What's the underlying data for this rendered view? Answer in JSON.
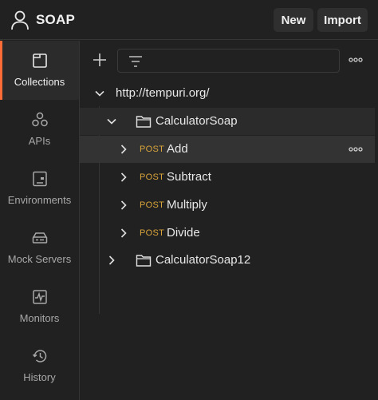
{
  "header": {
    "workspace_name": "SOAP",
    "new_label": "New",
    "import_label": "Import"
  },
  "sidebar": {
    "items": [
      {
        "label": "Collections",
        "icon": "collections-icon",
        "active": true
      },
      {
        "label": "APIs",
        "icon": "apis-icon",
        "active": false
      },
      {
        "label": "Environments",
        "icon": "environments-icon",
        "active": false
      },
      {
        "label": "Mock Servers",
        "icon": "mock-servers-icon",
        "active": false
      },
      {
        "label": "Monitors",
        "icon": "monitors-icon",
        "active": false
      },
      {
        "label": "History",
        "icon": "history-icon",
        "active": false
      }
    ]
  },
  "tree": {
    "root": "http://tempuri.org/",
    "folder1": "CalculatorSoap",
    "requests": [
      {
        "method": "POST",
        "name": "Add"
      },
      {
        "method": "POST",
        "name": "Subtract"
      },
      {
        "method": "POST",
        "name": "Multiply"
      },
      {
        "method": "POST",
        "name": "Divide"
      }
    ],
    "folder2": "CalculatorSoap12"
  },
  "colors": {
    "accent": "#ff6c37",
    "post_method": "#d9a43a",
    "background": "#212121"
  }
}
